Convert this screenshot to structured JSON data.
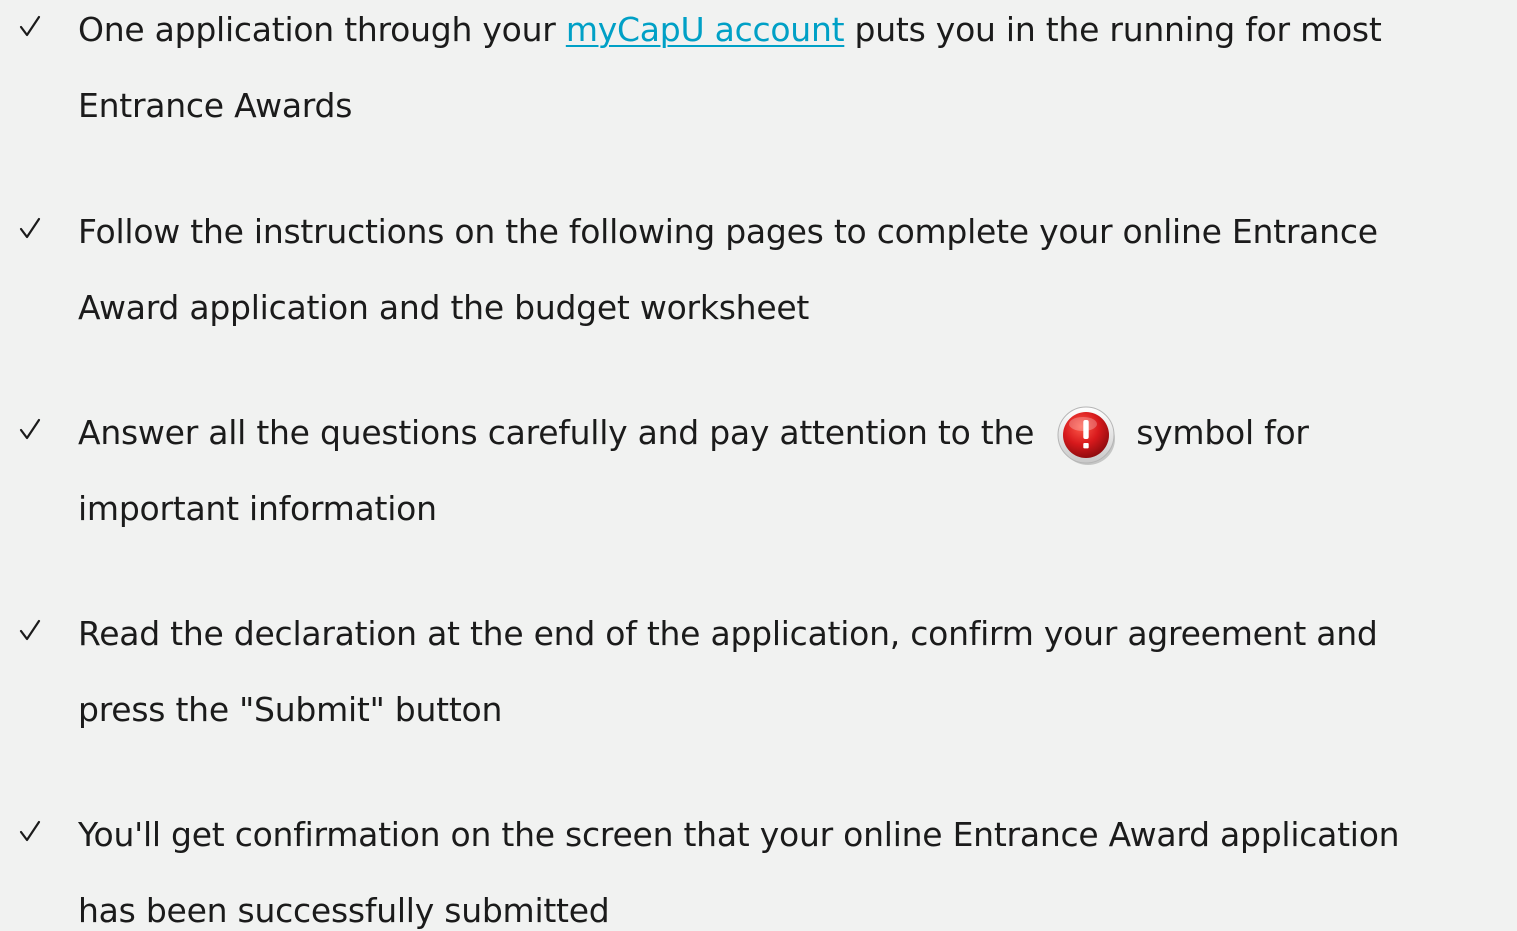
{
  "items": [
    {
      "line1_before": "One application through your ",
      "link_text": "myCapU account",
      "line1_after": " puts you in the running for most",
      "line2": "Entrance Awards"
    },
    {
      "line1": "Follow the instructions on the following pages to complete your online Entrance",
      "line2": "Award application and the budget worksheet"
    },
    {
      "line1_before": "Answer all the questions carefully and pay attention to the",
      "line1_after": "symbol for",
      "line2": "important information",
      "icon": "exclamation-warning-icon",
      "icon_color": "#d7191c"
    },
    {
      "line1": "Read the declaration at the end of the application, confirm your agreement and",
      "line2": "press the \"Submit\" button"
    },
    {
      "line1": "You'll get confirmation on the screen that your online Entrance Award application",
      "line2": "has been successfully submitted"
    }
  ],
  "colors": {
    "background": "#f1f2f1",
    "text": "#1b1b1b",
    "link": "#00a0c6"
  },
  "bullet_icon": "checkmark-icon"
}
